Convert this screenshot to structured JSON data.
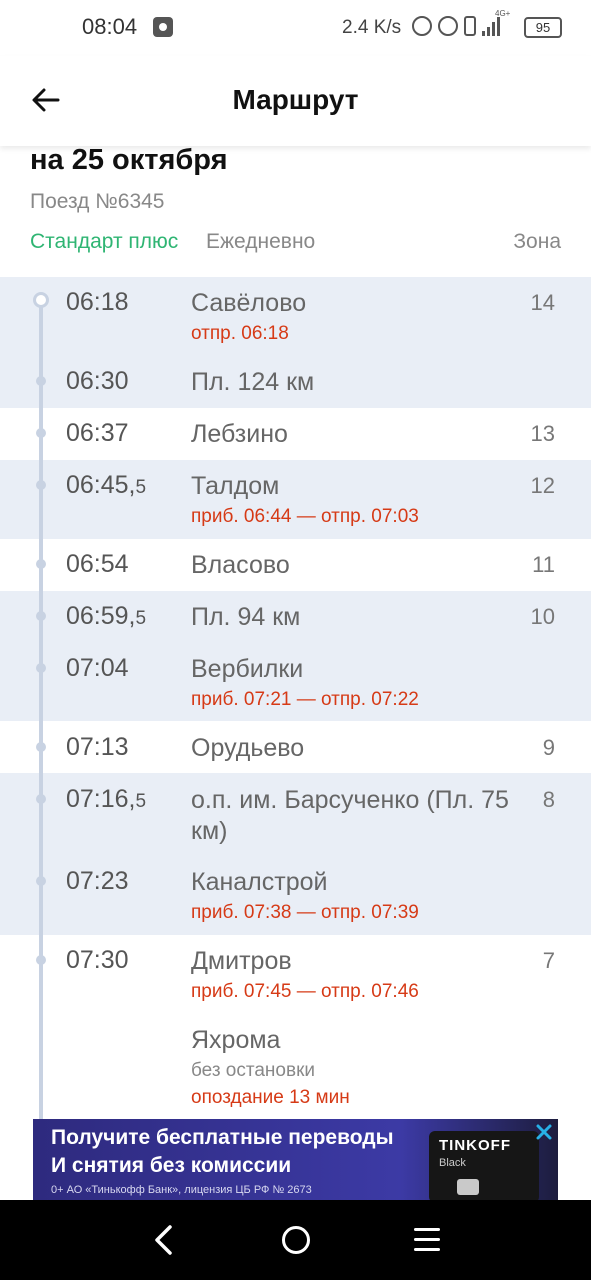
{
  "status_bar": {
    "time": "08:04",
    "net_speed": "2.4 K/s",
    "network_label": "4G+",
    "battery": "95"
  },
  "header": {
    "title": "Маршрут",
    "back_icon": "arrow-left-icon"
  },
  "trip": {
    "date": "на 25 октября",
    "train": "Поезд №6345",
    "tariff": "Стандарт плюс",
    "frequency": "Ежедневно",
    "zone_header": "Зона"
  },
  "stops": [
    {
      "time": "06:18",
      "time_frac": "",
      "name": "Савёлово",
      "zone": "14",
      "sub": "отпр. 06:18"
    },
    {
      "time": "06:30",
      "time_frac": "",
      "name": "Пл. 124 км",
      "zone": "",
      "sub": ""
    },
    {
      "time": "06:37",
      "time_frac": "",
      "name": "Лебзино",
      "zone": "13",
      "sub": ""
    },
    {
      "time": "06:45,",
      "time_frac": "5",
      "name": "Талдом",
      "zone": "12",
      "sub": "приб. 06:44 — отпр. 07:03"
    },
    {
      "time": "06:54",
      "time_frac": "",
      "name": "Власово",
      "zone": "11",
      "sub": ""
    },
    {
      "time": "06:59,",
      "time_frac": "5",
      "name": "Пл. 94 км",
      "zone": "10",
      "sub": ""
    },
    {
      "time": "07:04",
      "time_frac": "",
      "name": "Вербилки",
      "zone": "",
      "sub": "приб. 07:21 — отпр. 07:22"
    },
    {
      "time": "07:13",
      "time_frac": "",
      "name": "Орудьево",
      "zone": "9",
      "sub": ""
    },
    {
      "time": "07:16,",
      "time_frac": "5",
      "name": "о.п. им. Барсученко (Пл. 75 км)",
      "zone": "8",
      "sub": ""
    },
    {
      "time": "07:23",
      "time_frac": "",
      "name": "Каналстрой",
      "zone": "",
      "sub": "приб. 07:38 — отпр. 07:39"
    },
    {
      "time": "07:30",
      "time_frac": "",
      "name": "Дмитров",
      "zone": "7",
      "sub": "приб. 07:45 — отпр. 07:46"
    },
    {
      "time": "",
      "time_frac": "",
      "name": "Яхрома",
      "zone": "",
      "sub": "без остановки",
      "sub2": "опоздание 13 мин"
    }
  ],
  "ad": {
    "line1": "Получите бесплатные переводы",
    "line2": "И снятия без комиссии",
    "legal": "0+ АО «Тинькофф Банк», лицензия ЦБ РФ № 2673",
    "card_brand": "TINKOFF",
    "card_type": "Black"
  },
  "colors": {
    "accent_green": "#2fb573",
    "delay_red": "#d63a16",
    "band_shade": "#e9eef6"
  }
}
